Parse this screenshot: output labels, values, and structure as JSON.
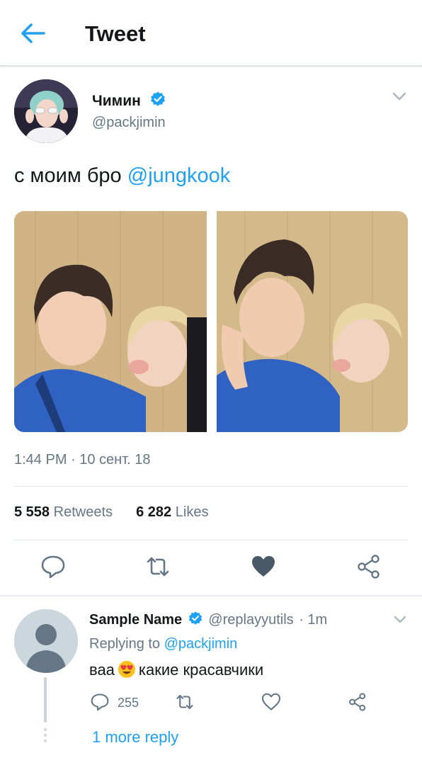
{
  "header": {
    "title": "Tweet"
  },
  "tweet": {
    "author_name": "Чимин",
    "author_handle": "@packjimin",
    "text_prefix": "с моим бро ",
    "mention": "@jungkook",
    "timestamp": "1:44 PM · 10 сент. 18",
    "retweets_count": "5 558",
    "retweets_label": "Retweets",
    "likes_count": "6 282",
    "likes_label": "Likes"
  },
  "reply": {
    "name": "Sample Name",
    "handle": "@replayyutils",
    "time": "· 1m",
    "replying_label": "Replying to",
    "replying_to": "@packjimin",
    "text_before_emoji": "ваа",
    "text_after_emoji": "какие красавчики",
    "reply_count": "255",
    "more_replies": "1 more reply"
  },
  "colors": {
    "accent": "#1da1f2",
    "muted_text": "#657786",
    "liked_heart": "#4a5968",
    "divider": "#e1e8ed"
  },
  "icons": [
    "back-arrow-icon",
    "verified-badge-icon",
    "chevron-down-icon",
    "reply-icon",
    "retweet-icon",
    "heart-icon",
    "share-icon",
    "emoji-heart-eyes-icon"
  ]
}
